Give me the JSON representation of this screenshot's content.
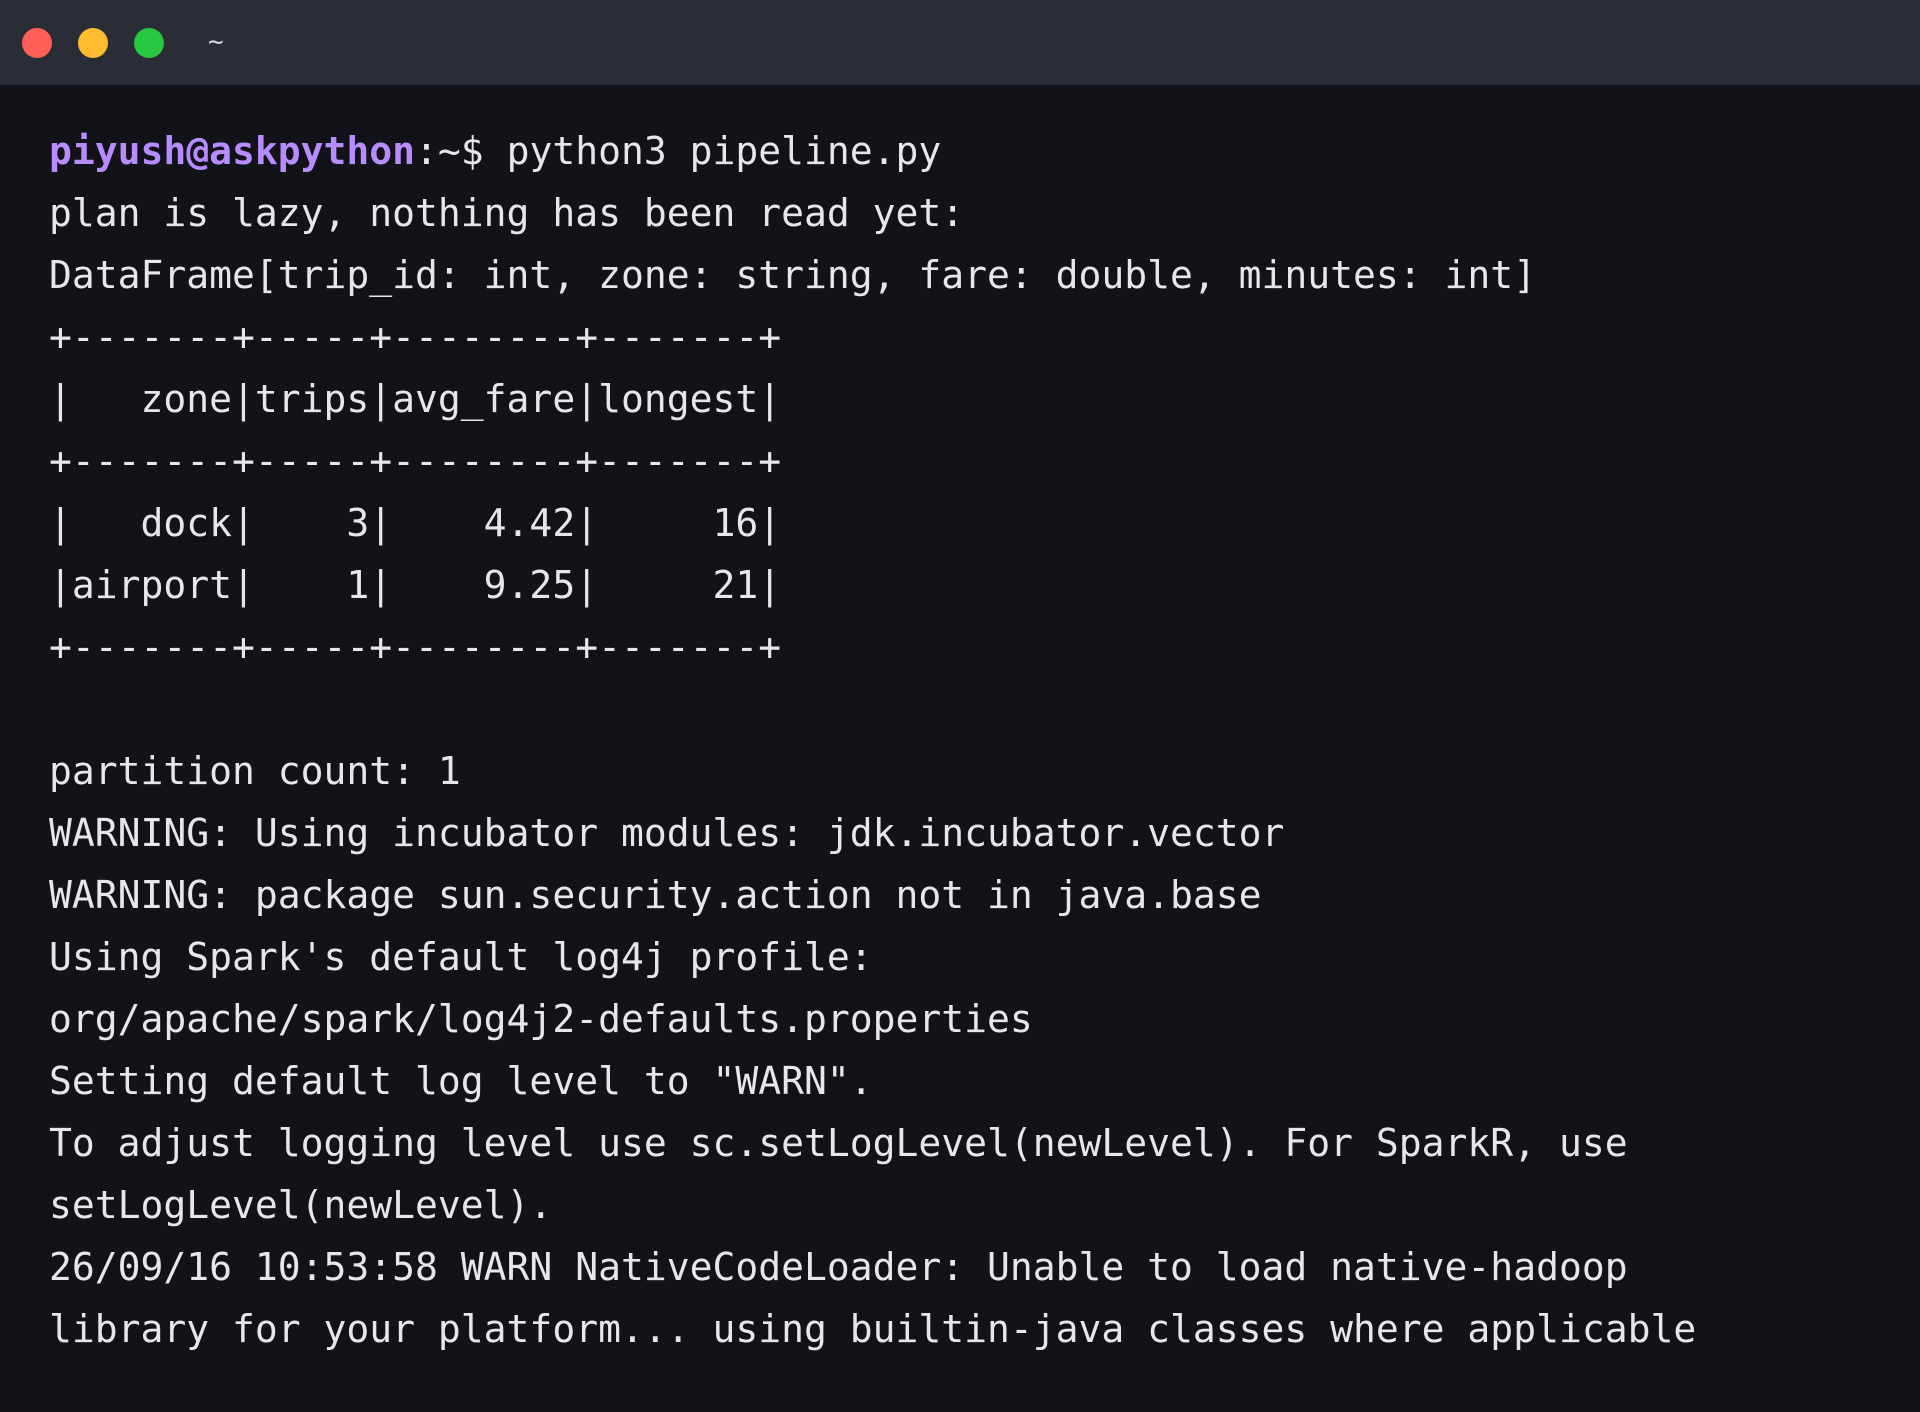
{
  "window": {
    "title": "~",
    "colors": {
      "background": "#121318",
      "titlebar": "#2a2d35",
      "text": "#e6e7eb",
      "prompt_user": "#b78cff",
      "close": "#ff5f57",
      "minimize": "#febc2e",
      "maximize": "#28c840"
    }
  },
  "terminal": {
    "prompt": {
      "user_host": "piyush@askpython",
      "suffix": ":~$",
      "command": " python3 pipeline.py"
    },
    "lines": [
      "plan is lazy, nothing has been read yet:",
      "DataFrame[trip_id: int, zone: string, fare: double, minutes: int]",
      "+-------+-----+--------+-------+",
      "|   zone|trips|avg_fare|longest|",
      "+-------+-----+--------+-------+",
      "|   dock|    3|    4.42|     16|",
      "|airport|    1|    9.25|     21|",
      "+-------+-----+--------+-------+",
      "",
      "partition count: 1",
      "WARNING: Using incubator modules: jdk.incubator.vector",
      "WARNING: package sun.security.action not in java.base",
      "Using Spark's default log4j profile:",
      "org/apache/spark/log4j2-defaults.properties",
      "Setting default log level to \"WARN\".",
      "To adjust logging level use sc.setLogLevel(newLevel). For SparkR, use",
      "setLogLevel(newLevel).",
      "26/09/16 10:53:58 WARN NativeCodeLoader: Unable to load native-hadoop",
      "library for your platform... using builtin-java classes where applicable"
    ]
  }
}
